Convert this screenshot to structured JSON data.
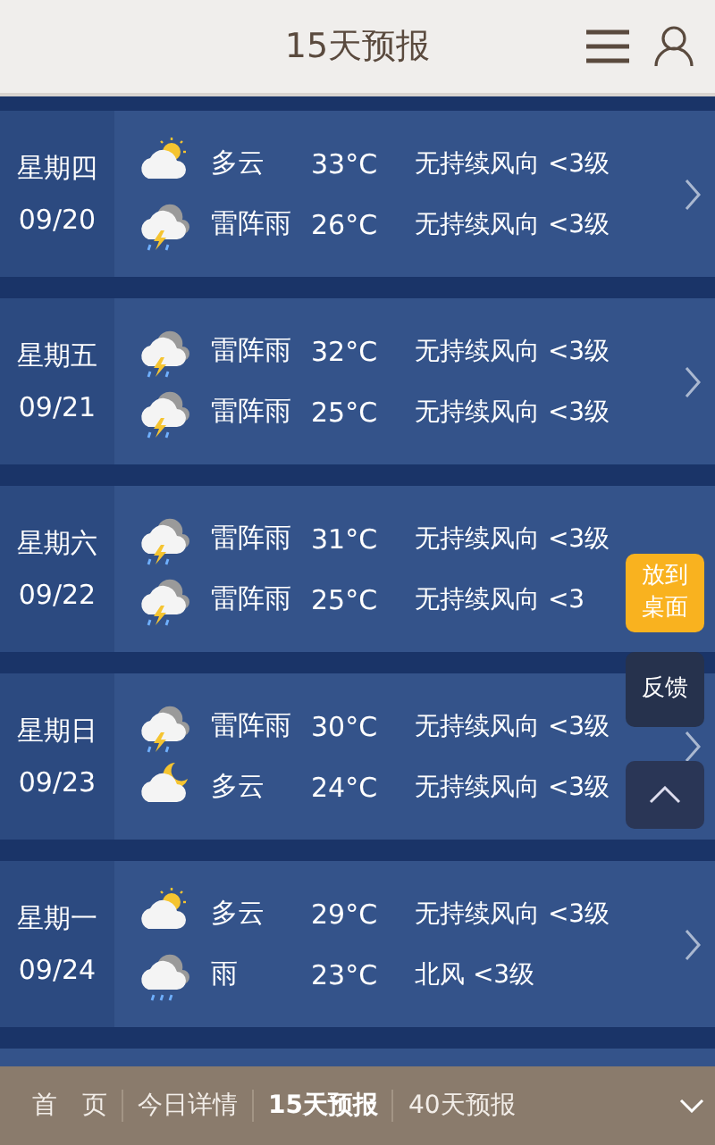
{
  "header": {
    "title": "15天预报"
  },
  "days": [
    {
      "weekday": "星期四",
      "date": "09/20",
      "periods": [
        {
          "kind": "cloud-sun",
          "condition": "多云",
          "temp": "33°C",
          "wind": "无持续风向 <3级"
        },
        {
          "kind": "thunder",
          "condition": "雷阵雨",
          "temp": "26°C",
          "wind": "无持续风向 <3级"
        }
      ]
    },
    {
      "weekday": "星期五",
      "date": "09/21",
      "periods": [
        {
          "kind": "thunder",
          "condition": "雷阵雨",
          "temp": "32°C",
          "wind": "无持续风向 <3级"
        },
        {
          "kind": "thunder",
          "condition": "雷阵雨",
          "temp": "25°C",
          "wind": "无持续风向 <3级"
        }
      ]
    },
    {
      "weekday": "星期六",
      "date": "09/22",
      "chevron": false,
      "periods": [
        {
          "kind": "thunder",
          "condition": "雷阵雨",
          "temp": "31°C",
          "wind": "无持续风向 <3级"
        },
        {
          "kind": "thunder",
          "condition": "雷阵雨",
          "temp": "25°C",
          "wind": "无持续风向 <3"
        }
      ]
    },
    {
      "weekday": "星期日",
      "date": "09/23",
      "periods": [
        {
          "kind": "thunder",
          "condition": "雷阵雨",
          "temp": "30°C",
          "wind": "无持续风向 <3级"
        },
        {
          "kind": "cloud-moon",
          "condition": "多云",
          "temp": "24°C",
          "wind": "无持续风向 <3级"
        }
      ]
    },
    {
      "weekday": "星期一",
      "date": "09/24",
      "periods": [
        {
          "kind": "cloud-sun",
          "condition": "多云",
          "temp": "29°C",
          "wind": "无持续风向 <3级"
        },
        {
          "kind": "rain",
          "condition": "雨",
          "temp": "23°C",
          "wind": "北风 <3级"
        }
      ]
    }
  ],
  "floating": {
    "pin": "放到桌面",
    "feedback": "反馈"
  },
  "nav": [
    {
      "label": "首　页",
      "selected": false
    },
    {
      "label": "今日详情",
      "selected": false
    },
    {
      "label": "15天预报",
      "selected": true
    },
    {
      "label": "40天预报",
      "selected": false
    }
  ]
}
